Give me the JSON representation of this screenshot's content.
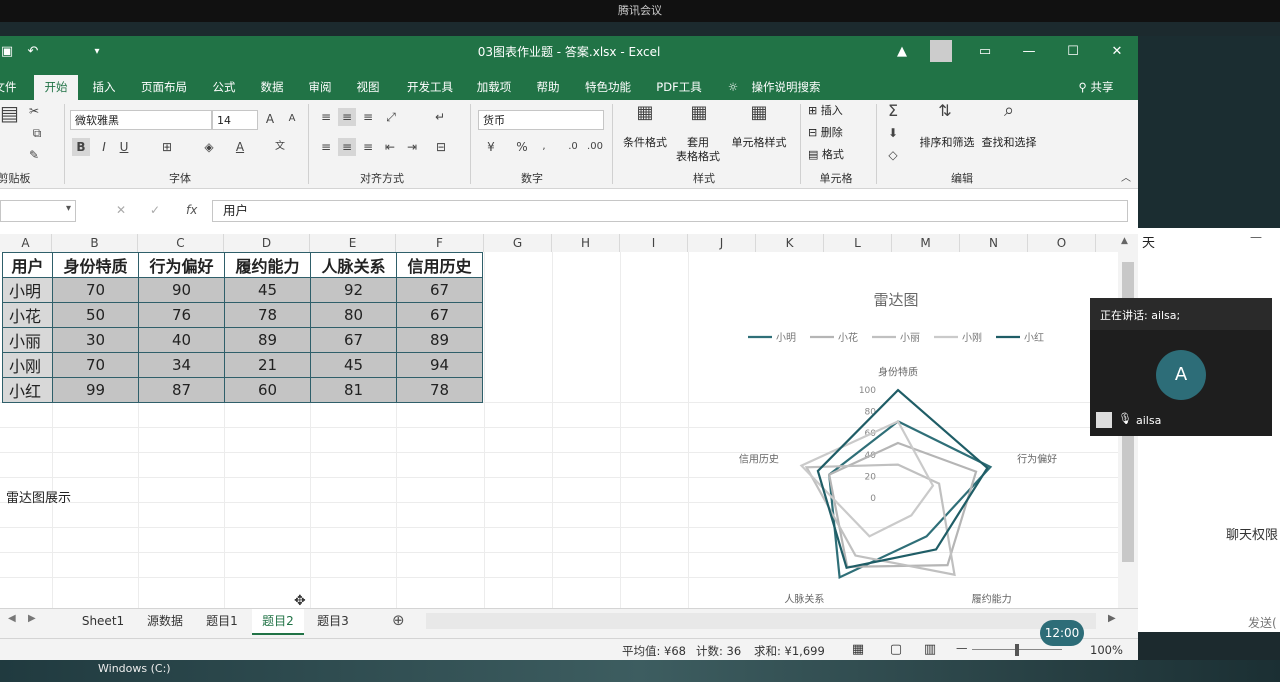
{
  "window": {
    "title": "03图表作业题 - 答案.xlsx  -  Excel",
    "top_notice": "腾讯会议"
  },
  "ribbon_tabs": [
    "文件",
    "开始",
    "插入",
    "页面布局",
    "公式",
    "数据",
    "审阅",
    "视图",
    "开发工具",
    "加载项",
    "帮助",
    "特色功能",
    "PDF工具",
    "操作说明搜索"
  ],
  "share_label": "共享",
  "ribbon": {
    "font_name": "微软雅黑",
    "font_size": "14",
    "number_format": "货币",
    "groups": [
      "剪贴板",
      "字体",
      "对齐方式",
      "数字",
      "样式",
      "单元格",
      "编辑"
    ],
    "cond_format": "条件格式",
    "table_format_1": "套用",
    "table_format_2": "表格格式",
    "cell_style": "单元格样式",
    "insert": "插入",
    "delete": "删除",
    "format": "格式",
    "sort_filter": "排序和筛选",
    "find_select": "查找和选择"
  },
  "formula": {
    "fx": "fx",
    "content": "用户"
  },
  "columns": [
    "A",
    "B",
    "C",
    "D",
    "E",
    "F",
    "G",
    "H",
    "I",
    "J",
    "K",
    "L",
    "M",
    "N",
    "O"
  ],
  "table": {
    "headers": [
      "用户",
      "身份特质",
      "行为偏好",
      "履约能力",
      "人脉关系",
      "信用历史"
    ],
    "rows": [
      [
        "小明",
        "70",
        "90",
        "45",
        "92",
        "67"
      ],
      [
        "小花",
        "50",
        "76",
        "78",
        "80",
        "67"
      ],
      [
        "小丽",
        "30",
        "40",
        "89",
        "67",
        "89"
      ],
      [
        "小刚",
        "70",
        "34",
        "21",
        "45",
        "94"
      ],
      [
        "小红",
        "99",
        "87",
        "60",
        "81",
        "78"
      ]
    ]
  },
  "note": "雷达图展示",
  "chart_data": {
    "type": "radar",
    "title": "雷达图",
    "axes": [
      "身份特质",
      "行为偏好",
      "履约能力",
      "人脉关系",
      "信用历史"
    ],
    "ticks": [
      "100",
      "80",
      "60",
      "40",
      "20",
      "0"
    ],
    "ylim": [
      0,
      100
    ],
    "legend_position": "top",
    "series": [
      {
        "name": "小明",
        "values": [
          70,
          90,
          45,
          92,
          67
        ],
        "color": "#2f6f78"
      },
      {
        "name": "小花",
        "values": [
          50,
          76,
          78,
          80,
          67
        ],
        "color": "#b5b5b5"
      },
      {
        "name": "小丽",
        "values": [
          30,
          40,
          89,
          67,
          89
        ],
        "color": "#c0c0c0"
      },
      {
        "name": "小刚",
        "values": [
          70,
          34,
          21,
          45,
          94
        ],
        "color": "#cacaca"
      },
      {
        "name": "小红",
        "values": [
          99,
          87,
          60,
          81,
          78
        ],
        "color": "#1f5d66"
      }
    ]
  },
  "sheet_tabs": [
    "Sheet1",
    "源数据",
    "题目1",
    "题目2",
    "题目3"
  ],
  "active_sheet": "题目2",
  "status": {
    "average": "平均值: ¥68",
    "count": "计数: 36",
    "sum": "求和: ¥1,699",
    "zoom": "100%"
  },
  "meeting": {
    "speaking": "正在讲话: ailsa;",
    "avatar_letter": "A",
    "user": "ailsa"
  },
  "chat": {
    "title_fragment": "天",
    "permission": "聊天权限",
    "send": "发送("
  },
  "clock": "12:00",
  "taskbar_item": "Windows (C:)"
}
